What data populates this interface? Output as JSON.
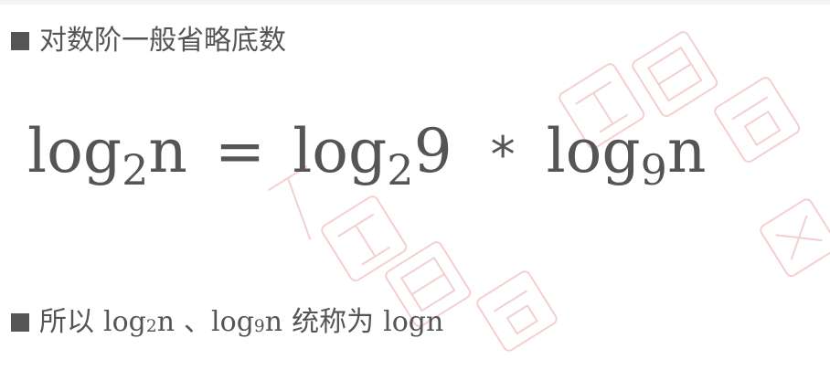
{
  "heading": {
    "text": "对数阶一般省略底数"
  },
  "formula": {
    "lhs_log": "log",
    "lhs_base": "2",
    "lhs_arg": "n",
    "equals": "=",
    "rhs1_log": "log",
    "rhs1_base": "2",
    "rhs1_arg": "9",
    "times": "*",
    "rhs2_log": "log",
    "rhs2_base": "9",
    "rhs2_arg": "n"
  },
  "conclusion": {
    "prefix": "所以",
    "term1_log": "log",
    "term1_base": "2",
    "term1_arg": "n",
    "separator": "、",
    "term2_log": "log",
    "term2_base": "9",
    "term2_arg": "n",
    "middle": "统称为",
    "result": "logn"
  },
  "colors": {
    "text": "#555555",
    "watermark": "#f3caca"
  }
}
